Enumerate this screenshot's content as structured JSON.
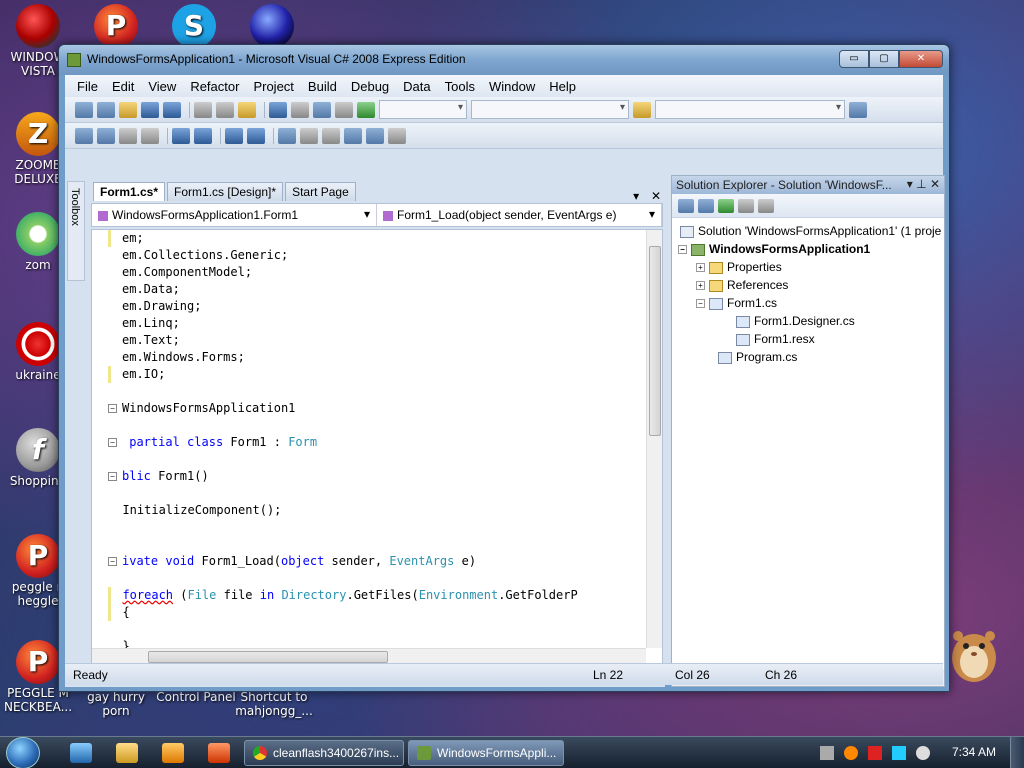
{
  "desktop": {
    "icons": [
      {
        "label": "WINDOW\nVISTA"
      },
      {
        "label": "ZOOME\nDELUXE"
      },
      {
        "label": "zom"
      },
      {
        "label": "ukraine"
      },
      {
        "label": "Shopping"
      },
      {
        "label": "peggle n\nheggle"
      },
      {
        "label": "PEGGLE M\nNECKBEA..."
      },
      {
        "label": "gay hurry\nporn"
      },
      {
        "label": "Control Panel"
      },
      {
        "label": "Shortcut to\nmahjongg_..."
      }
    ]
  },
  "window": {
    "title": "WindowsFormsApplication1 - Microsoft Visual C# 2008 Express Edition",
    "buttons": {
      "minimize": "▭",
      "maximize": "▢",
      "close": "✕"
    }
  },
  "menu": [
    "File",
    "Edit",
    "View",
    "Refactor",
    "Project",
    "Build",
    "Debug",
    "Data",
    "Tools",
    "Window",
    "Help"
  ],
  "toolbox_label": "Toolbox",
  "tabs": [
    {
      "label": "Form1.cs*",
      "active": true
    },
    {
      "label": "Form1.cs [Design]*",
      "active": false
    },
    {
      "label": "Start Page",
      "active": false
    }
  ],
  "nav": {
    "class_combo": "WindowsFormsApplication1.Form1",
    "member_combo": "Form1_Load(object sender, EventArgs e)"
  },
  "code_lines": [
    "em;",
    "em.Collections.Generic;",
    "em.ComponentModel;",
    "em.Data;",
    "em.Drawing;",
    "em.Linq;",
    "em.Text;",
    "em.Windows.Forms;",
    "em.IO;",
    "",
    "WindowsFormsApplication1",
    "",
    " partial class Form1 : Form",
    "",
    "blic Form1()",
    "",
    "  InitializeComponent();",
    "",
    "",
    "ivate void Form1_Load(object sender, EventArgs e)",
    "",
    "  foreach (File file in Directory.GetFiles(Environment.GetFolderP",
    "  {",
    "",
    "  }"
  ],
  "solution_explorer": {
    "title": "Solution Explorer - Solution 'WindowsF...",
    "ctrls": "▾ ⊥ ✕",
    "nodes": [
      {
        "label": "Solution 'WindowsFormsApplication1' (1 proje"
      },
      {
        "label": "WindowsFormsApplication1"
      },
      {
        "label": "Properties"
      },
      {
        "label": "References"
      },
      {
        "label": "Form1.cs"
      },
      {
        "label": "Form1.Designer.cs"
      },
      {
        "label": "Form1.resx"
      },
      {
        "label": "Program.cs"
      }
    ]
  },
  "status": {
    "text": "Ready",
    "ln": "Ln 22",
    "col": "Col 26",
    "ch": "Ch 26"
  },
  "taskbar": {
    "buttons": [
      {
        "label": "cleanflash3400267ins..."
      },
      {
        "label": "WindowsFormsAppli..."
      }
    ],
    "clock": "7:34 AM"
  }
}
